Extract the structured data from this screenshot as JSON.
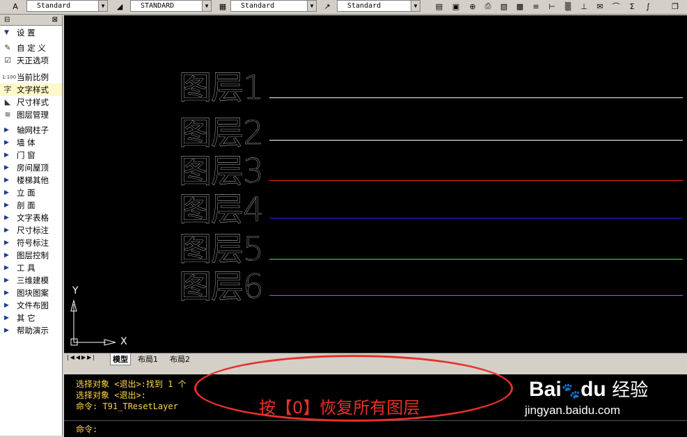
{
  "toolbar": {
    "combos": [
      "Standard",
      "STANDARD",
      "Standard",
      "Standard"
    ],
    "icons": [
      "text-style-icon",
      "dim-style-icon",
      "table-style-icon",
      "multileader-style-icon",
      "properties-icon",
      "layer-icon",
      "insert-icon",
      "plot-icon",
      "image-icon",
      "settings-icon",
      "text-icon",
      "dimension-icon",
      "hatch-icon",
      "mail-icon",
      "leader-icon",
      "sum-text-icon",
      "arc-icon",
      "window-icon"
    ]
  },
  "sidebar": {
    "header": "设  置",
    "items": [
      {
        "label": "自 定 义",
        "icon": "customize-icon"
      },
      {
        "label": "天正选项",
        "icon": "options-icon"
      },
      {
        "label": "当前比例",
        "icon": "scale-icon"
      },
      {
        "label": "文字样式",
        "icon": "text-style-icon"
      },
      {
        "label": "尺寸样式",
        "icon": "dim-style-icon"
      },
      {
        "label": "图层管理",
        "icon": "layer-manage-icon"
      }
    ],
    "menus": [
      "轴网柱子",
      "墙    体",
      "门    窗",
      "房间屋顶",
      "楼梯其他",
      "立    面",
      "剖    面",
      "文字表格",
      "尺寸标注",
      "符号标注",
      "图层控制",
      "工    具",
      "三维建模",
      "图块图案",
      "文件布图",
      "其    它",
      "帮助演示"
    ]
  },
  "canvas": {
    "layers": [
      {
        "label": "图层1",
        "color": "#ffffff"
      },
      {
        "label": "图层2",
        "color": "#ffffff"
      },
      {
        "label": "图层3",
        "color": "#ff2020"
      },
      {
        "label": "图层4",
        "color": "#2020ff"
      },
      {
        "label": "图层5",
        "color": "#20ff20"
      },
      {
        "label": "图层6",
        "color": "#ff20ff"
      }
    ],
    "axis_x": "X",
    "axis_y": "Y"
  },
  "tabs": [
    "模型",
    "布局1",
    "布局2"
  ],
  "command": {
    "lines": [
      "选择对象 <退出>:找到 1 个",
      "选择对象 <退出>:",
      "命令: T91_TResetLayer"
    ],
    "prompt": "命令:"
  },
  "annotation": "按【0】恢复所有图层",
  "watermark": {
    "brand": "Bai",
    "brand2": "du",
    "sub": "经验",
    "url": "jingyan.baidu.com"
  }
}
